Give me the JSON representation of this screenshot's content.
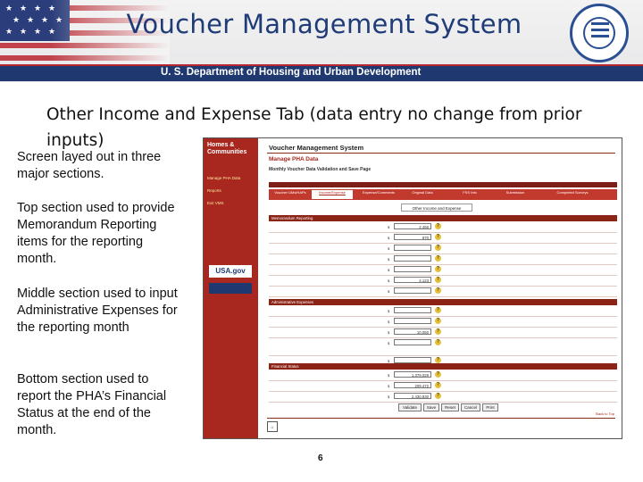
{
  "header": {
    "title": "Voucher Management System",
    "department": "U. S. Department of Housing and Urban Development"
  },
  "slide": {
    "title": "Other Income and Expense Tab (data entry no change from prior inputs)",
    "bullets": [
      "Screen layed out in three major sections.",
      "Top section used to provide Memorandum Reporting items for the reporting month.",
      "Middle section used to input Administrative Expenses for the reporting month",
      "Bottom section used to report the PHA’s Financial Status at the end of the month."
    ],
    "page_number": "6"
  },
  "screenshot": {
    "sidebar": {
      "header": "Homes & Communities",
      "items": [
        "Manage PHA Data",
        "Reports",
        "Exit VMS"
      ],
      "usa_badge": "USA.gov"
    },
    "content": {
      "app_title": "Voucher Management System",
      "page_title": "Manage PHA Data",
      "subtitle": "Monthly Voucher Data Validation and Save Page",
      "tabs": [
        "Voucher UMs/HAPs",
        "Income/Expense",
        "Expense/Comments",
        "Original Data",
        "FSS Info",
        "Submission",
        "Completed Surveys"
      ],
      "other_tab": "Other Income and Expense",
      "sections": [
        "Memorandum Reporting",
        "Administrative Expenses",
        "Financial Status"
      ],
      "rows": [
        {
          "value": "2,456"
        },
        {
          "value": "870"
        },
        {
          "value": ""
        },
        {
          "value": ""
        },
        {
          "value": ""
        },
        {
          "value": "4,123"
        },
        {
          "value": ""
        },
        {
          "value": ""
        },
        {
          "value": ""
        },
        {
          "value": "10,050"
        },
        {
          "value": ""
        },
        {
          "value": ""
        },
        {
          "value": "1,379,029"
        },
        {
          "value": "209,472"
        },
        {
          "value": "2,430,830"
        }
      ],
      "buttons": [
        "Validate",
        "Save",
        "Reset",
        "Cancel",
        "Print"
      ],
      "top_link": "Back to Top"
    }
  },
  "colors": {
    "title_blue": "#1f3b78",
    "hud_bar": "#1f3970",
    "sidebar_red": "#a8281f",
    "section_red": "#8b2317"
  }
}
